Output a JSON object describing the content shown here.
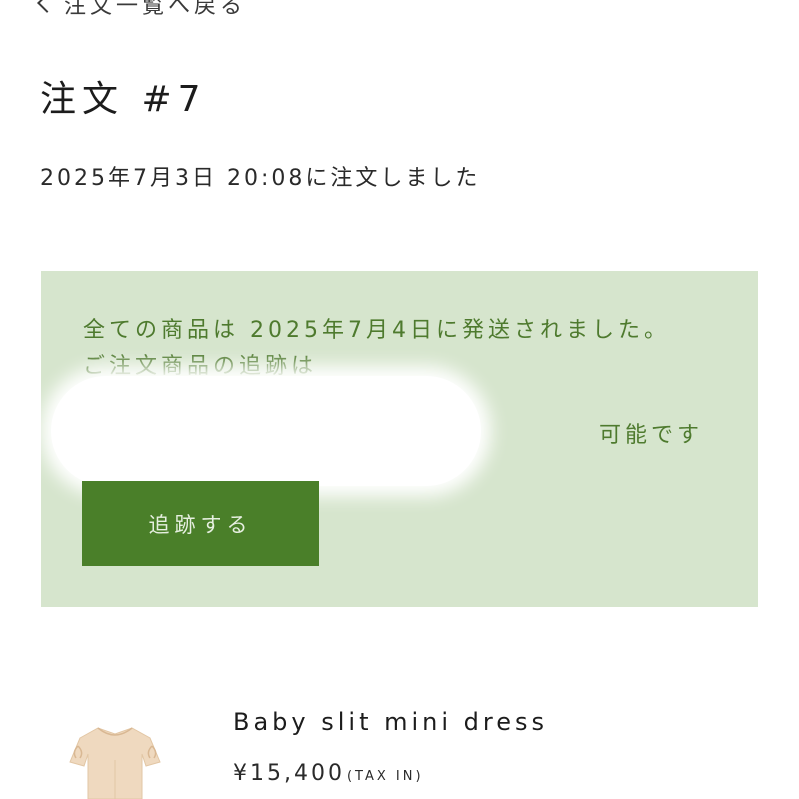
{
  "header": {
    "back_label": "注文一覧へ戻る",
    "back_icon": "chevron-left-icon"
  },
  "order": {
    "title": "注文 #7",
    "placed_text": "2025年7月3日 20:08に注文しました"
  },
  "shipping_notice": {
    "message": "全ての商品は 2025年7月4日に発送されました。 ご注文商品の追跡は",
    "availability": "可能です",
    "track_button_label": "追跡する",
    "colors": {
      "panel_bg": "#d6e5cd",
      "text": "#4e7a2e",
      "button_bg": "#4a7f29"
    }
  },
  "product": {
    "name": "Baby slit mini dress",
    "price": "¥15,400",
    "tax_note": "(TAX IN)"
  }
}
